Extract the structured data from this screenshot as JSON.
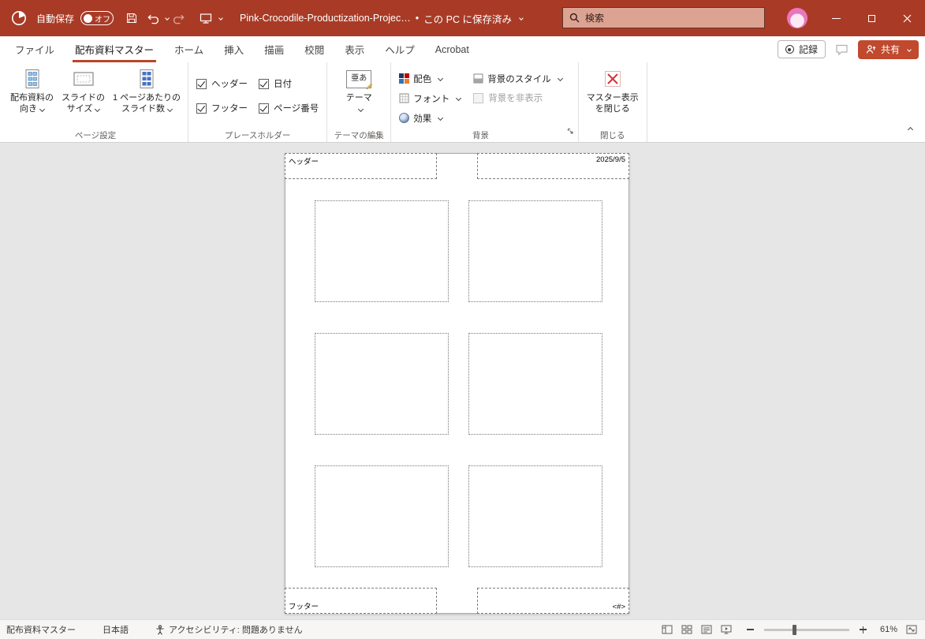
{
  "titlebar": {
    "autosave_label": "自動保存",
    "autosave_state": "オフ",
    "document_title": "Pink-Crocodile-Productization-Projec…",
    "save_separator": "•",
    "save_status": "この PC に保存済み",
    "search_placeholder": "検索"
  },
  "tabs": [
    {
      "label": "ファイル"
    },
    {
      "label": "配布資料マスター"
    },
    {
      "label": "ホーム"
    },
    {
      "label": "挿入"
    },
    {
      "label": "描画"
    },
    {
      "label": "校閲"
    },
    {
      "label": "表示"
    },
    {
      "label": "ヘルプ"
    },
    {
      "label": "Acrobat"
    }
  ],
  "actions": {
    "record": "記録",
    "share": "共有"
  },
  "ribbon": {
    "page_setup": {
      "group_label": "ページ設定",
      "orientation": [
        "配布資料の",
        "向き"
      ],
      "slide_size": [
        "スライドの",
        "サイズ"
      ],
      "slides_per_page": [
        "1 ページあたりの",
        "スライド数"
      ]
    },
    "placeholders": {
      "group_label": "プレースホルダー",
      "header": "ヘッダー",
      "footer": "フッター",
      "date": "日付",
      "page_number": "ページ番号"
    },
    "edit_theme": {
      "group_label": "テーマの編集",
      "themes": "テーマ",
      "theme_icon_text": "亜あ"
    },
    "background": {
      "group_label": "背景",
      "colors": "配色",
      "fonts": "フォント",
      "effects": "効果",
      "styles": "背景のスタイル",
      "hide": "背景を非表示"
    },
    "close": {
      "group_label": "閉じる",
      "button": [
        "マスター表示",
        "を閉じる"
      ]
    }
  },
  "canvas": {
    "header": "ヘッダー",
    "date": "2025/9/5",
    "footer": "フッター",
    "page_number": "<#>"
  },
  "statusbar": {
    "view_label": "配布資料マスター",
    "language": "日本語",
    "accessibility": "アクセシビリティ: 問題ありません",
    "zoom_level": "61%"
  }
}
